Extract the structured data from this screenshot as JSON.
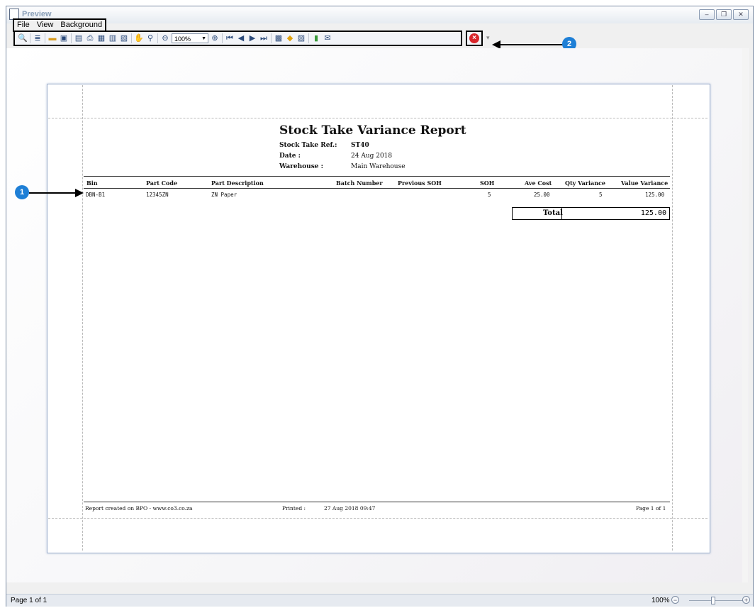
{
  "window": {
    "title": "Preview"
  },
  "menu": {
    "items": [
      {
        "label": "File"
      },
      {
        "label": "View"
      },
      {
        "label": "Background"
      }
    ]
  },
  "toolbar": {
    "zoom_value": "100%",
    "icons": [
      "search-icon",
      "find-icon",
      "open-icon",
      "save-icon",
      "page-setup-icon",
      "print-icon",
      "quick-print-icon",
      "header-footer-icon",
      "scale-icon",
      "hand-tool-icon",
      "magnifier-icon",
      "zoom-out-icon",
      "zoom-in-icon",
      "first-page-icon",
      "prev-page-icon",
      "next-page-icon",
      "last-page-icon",
      "multiple-pages-icon",
      "color-icon",
      "watermark-icon",
      "export-icon",
      "email-icon",
      "close-preview-icon"
    ]
  },
  "callouts": {
    "one": "1",
    "two": "2"
  },
  "report": {
    "title": "Stock Take Variance Report",
    "ref_label": "Stock Take Ref.:",
    "ref_value": "ST40",
    "date_label": "Date :",
    "date_value": "24 Aug 2018",
    "warehouse_label": "Warehouse :",
    "warehouse_value": "Main Warehouse",
    "columns": [
      "Bin",
      "Part Code",
      "Part Description",
      "Batch Number",
      "Previous SOH",
      "SOH",
      "Ave Cost",
      "Qty Variance",
      "Value Variance"
    ],
    "rows": [
      {
        "bin": "DBN-B1",
        "part_code": "12345ZN",
        "description": "ZN Paper",
        "batch": "",
        "previous_soh": "",
        "soh": "5",
        "ave_cost": "25.00",
        "qty_variance": "5",
        "value_variance": "125.00"
      }
    ],
    "total_label": "Total",
    "total_value": "125.00",
    "footer_left": "Report created on BPO - www.co3.co.za",
    "printed_label": "Printed :",
    "printed_value": "27 Aug 2018 09:47",
    "page_label": "Page 1 of 1"
  },
  "status": {
    "page": "Page 1 of 1",
    "zoom": "100%"
  }
}
